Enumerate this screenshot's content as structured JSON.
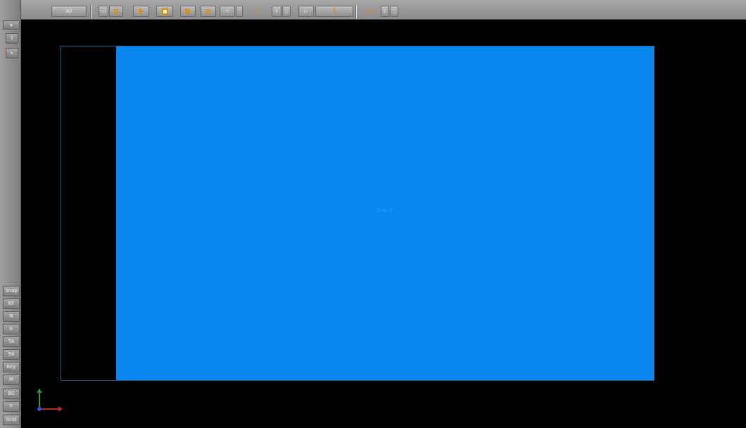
{
  "toolbar": {
    "all_label": "All",
    "frame_value": "0",
    "fps_value": "50"
  },
  "left_toolbar": {
    "buttons": [
      "Snap",
      "KF",
      "N",
      "E",
      "TA",
      "SA",
      "Key",
      "M",
      "BS",
      "F",
      "Grid"
    ],
    "top_buttons": [
      "1",
      "L"
    ]
  },
  "canvas": {
    "clip_label": "Clip 1",
    "clip_color": "#0a86f0",
    "background_color": "#000000",
    "frame_border_color": "#1b5f86"
  }
}
